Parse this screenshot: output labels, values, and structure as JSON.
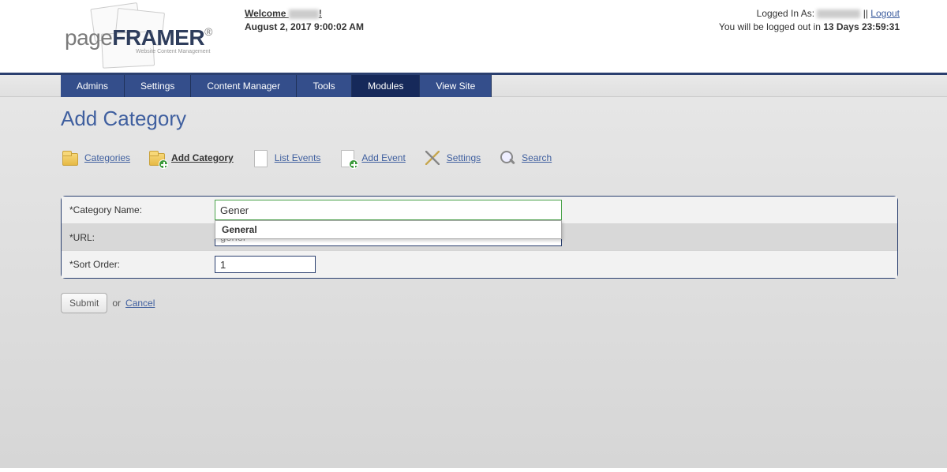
{
  "header": {
    "welcome_prefix": "Welcome ",
    "welcome_suffix": "!",
    "date": "August 2, 2017 9:00:02 AM",
    "logged_in_prefix": "Logged In As: ",
    "separator": " || ",
    "logout_label": "Logout",
    "timeout_prefix": "You will be logged out in ",
    "timeout_value": "13 Days 23:59:31"
  },
  "logo": {
    "part1": "page",
    "part2": "FRAMER",
    "sub": "Website Content Management"
  },
  "nav": {
    "items": [
      "Admins",
      "Settings",
      "Content Manager",
      "Tools",
      "Modules",
      "View Site"
    ],
    "active_index": 4
  },
  "page_title": "Add Category",
  "iconbar": {
    "items": [
      {
        "label": "Categories",
        "icon": "folder",
        "active": false
      },
      {
        "label": "Add Category",
        "icon": "folder-plus",
        "active": true
      },
      {
        "label": "List Events",
        "icon": "page",
        "active": false
      },
      {
        "label": "Add Event",
        "icon": "page-plus",
        "active": false
      },
      {
        "label": "Settings",
        "icon": "tools",
        "active": false
      },
      {
        "label": "Search",
        "icon": "search",
        "active": false
      }
    ]
  },
  "form": {
    "category_name_label": "*Category Name:",
    "category_name_value": "Gener",
    "autocomplete_option": "General",
    "url_label": "*URL:",
    "url_value": "gener",
    "sort_label": "*Sort Order:",
    "sort_value": "1"
  },
  "actions": {
    "submit_label": "Submit",
    "or_text": " or ",
    "cancel_label": "Cancel"
  }
}
